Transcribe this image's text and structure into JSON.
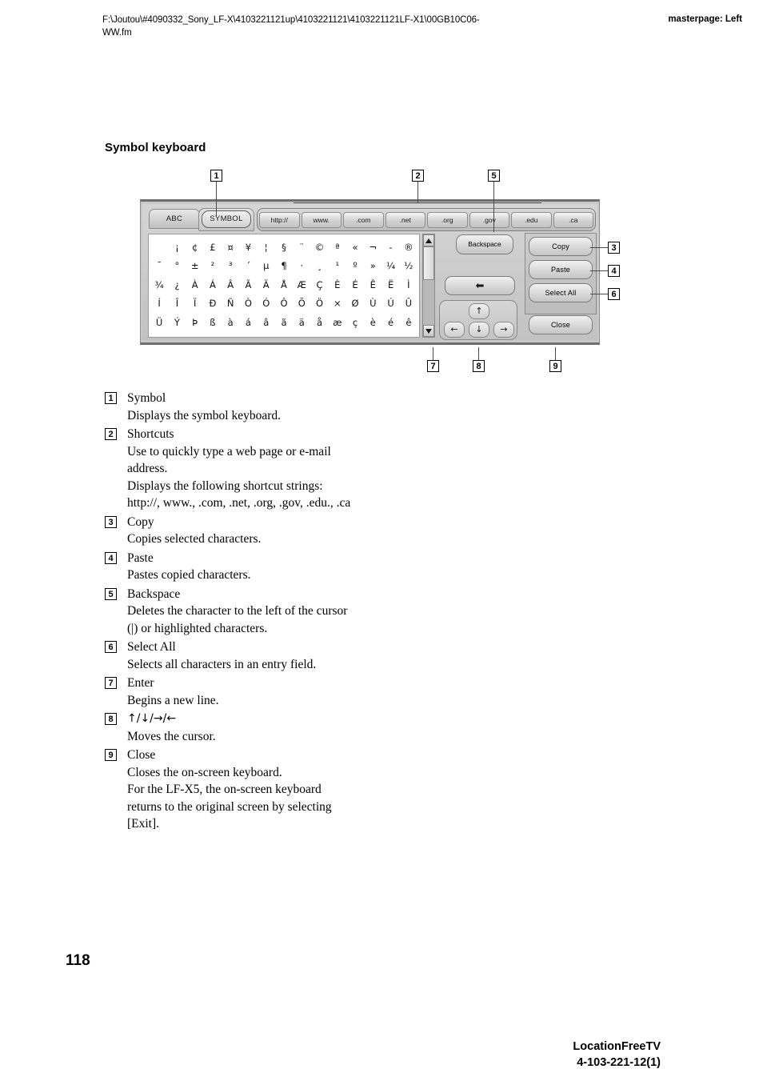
{
  "header": {
    "path": "F:\\Joutou\\#4090332_Sony_LF-X\\4103221121up\\4103221121\\4103221121LF-X1\\00GB10C06-WW.fm",
    "masterpage": "masterpage: Left"
  },
  "section": {
    "title": "Symbol keyboard"
  },
  "figure": {
    "callouts": [
      "1",
      "2",
      "3",
      "4",
      "5",
      "6",
      "7",
      "8",
      "9"
    ],
    "tabs": [
      {
        "label": "ABC",
        "selected": false
      },
      {
        "label": "SYMBOL",
        "selected": true
      }
    ],
    "shortcuts": [
      "http://",
      "www.",
      ".com",
      ".net",
      ".org",
      ".gov",
      ".edu",
      ".ca"
    ],
    "symbol_rows": [
      [
        "",
        "¡",
        "¢",
        "£",
        "¤",
        "¥",
        "¦",
        "§",
        "¨",
        "©",
        "ª",
        "«",
        "¬",
        "-",
        "®"
      ],
      [
        "¯",
        "°",
        "±",
        "²",
        "³",
        "´",
        "µ",
        "¶",
        "·",
        "¸",
        "¹",
        "º",
        "»",
        "¼",
        "½"
      ],
      [
        "¾",
        "¿",
        "À",
        "Á",
        "Â",
        "Ã",
        "Ä",
        "Å",
        "Æ",
        "Ç",
        "È",
        "É",
        "Ê",
        "Ë",
        "Ì"
      ],
      [
        "Í",
        "Î",
        "Ï",
        "Ð",
        "Ñ",
        "Ò",
        "Ó",
        "Ô",
        "Õ",
        "Ö",
        "×",
        "Ø",
        "Ù",
        "Ú",
        "Û"
      ],
      [
        "Ü",
        "Ý",
        "Þ",
        "ß",
        "à",
        "á",
        "â",
        "ã",
        "ä",
        "å",
        "æ",
        "ç",
        "è",
        "é",
        "ê"
      ]
    ],
    "buttons": {
      "backspace": "Backspace",
      "copy": "Copy",
      "paste": "Paste",
      "select_all": "Select All",
      "close": "Close",
      "enter": "⬅",
      "arrow_up": "↑",
      "arrow_down": "↓",
      "arrow_left": "←",
      "arrow_right": "→"
    },
    "scrollbar": {
      "up": "▲",
      "down": "▼"
    }
  },
  "descriptions": [
    {
      "num": "1",
      "title": "Symbol",
      "lines": [
        "Displays the symbol keyboard."
      ]
    },
    {
      "num": "2",
      "title": "Shortcuts",
      "lines": [
        "Use to quickly type a web page or e-mail",
        "address.",
        "Displays the following shortcut strings:",
        "http://, www., .com, .net, .org, .gov, .edu., .ca"
      ]
    },
    {
      "num": "3",
      "title": "Copy",
      "lines": [
        "Copies selected characters."
      ]
    },
    {
      "num": "4",
      "title": "Paste",
      "lines": [
        "Pastes copied characters."
      ]
    },
    {
      "num": "5",
      "title": " Backspace",
      "lines": [
        "Deletes the character to the left of the cursor",
        "(|) or highlighted characters."
      ]
    },
    {
      "num": "6",
      "title": "Select All",
      "lines": [
        "Selects all characters in an entry field."
      ]
    },
    {
      "num": "7",
      "title": "Enter",
      "lines": [
        "Begins a new line."
      ]
    },
    {
      "num": "8",
      "title": "↑/↓/→/←",
      "lines": [
        "Moves the cursor."
      ]
    },
    {
      "num": "9",
      "title": "Close",
      "lines": [
        "Closes the on-screen keyboard.",
        "For the LF-X5, the on-screen keyboard",
        "returns to the original screen by selecting",
        "[Exit]."
      ]
    }
  ],
  "footer": {
    "page_number": "118",
    "product": "LocationFreeTV",
    "doc_prefix": "4-103-221-",
    "doc_bold": "12",
    "doc_suffix": "(1)"
  }
}
